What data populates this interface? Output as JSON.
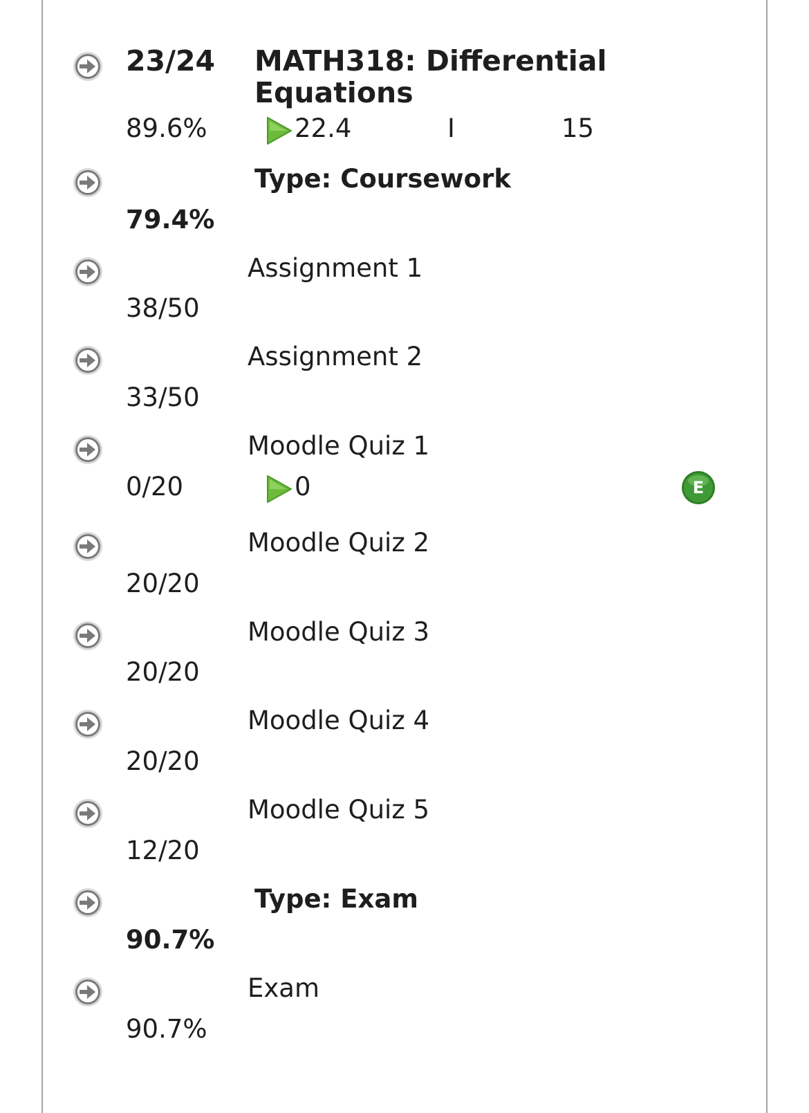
{
  "course": {
    "fraction": "23/24",
    "title_line1": "MATH318: Differential",
    "title_line2": "Equations",
    "percent": "89.6%",
    "points": "22.4",
    "status": "I",
    "credits": "15"
  },
  "categories": [
    {
      "label": "Type: Coursework",
      "percent": "79.4%",
      "items": [
        {
          "name": "Assignment 1",
          "grade": "38/50"
        },
        {
          "name": "Assignment 2",
          "grade": "33/50"
        },
        {
          "name": "Moodle Quiz 1",
          "grade": "0/20",
          "points": "0",
          "badge": "E"
        },
        {
          "name": "Moodle Quiz 2",
          "grade": "20/20"
        },
        {
          "name": "Moodle Quiz 3",
          "grade": "20/20"
        },
        {
          "name": "Moodle Quiz 4",
          "grade": "20/20"
        },
        {
          "name": "Moodle Quiz 5",
          "grade": "12/20"
        }
      ]
    },
    {
      "label": "Type: Exam",
      "percent": "90.7%",
      "items": [
        {
          "name": "Exam",
          "grade": "90.7%"
        }
      ]
    }
  ],
  "icons": {
    "row_arrow": "arrow-right-circle-icon",
    "points_marker": "play-triangle-icon",
    "badge": "e-badge-icon"
  },
  "colors": {
    "arrow_icon": "#757575",
    "play_icon": "#6dbb3c",
    "badge_green": "#3e9a34",
    "frame_border": "#a3a3a3"
  }
}
